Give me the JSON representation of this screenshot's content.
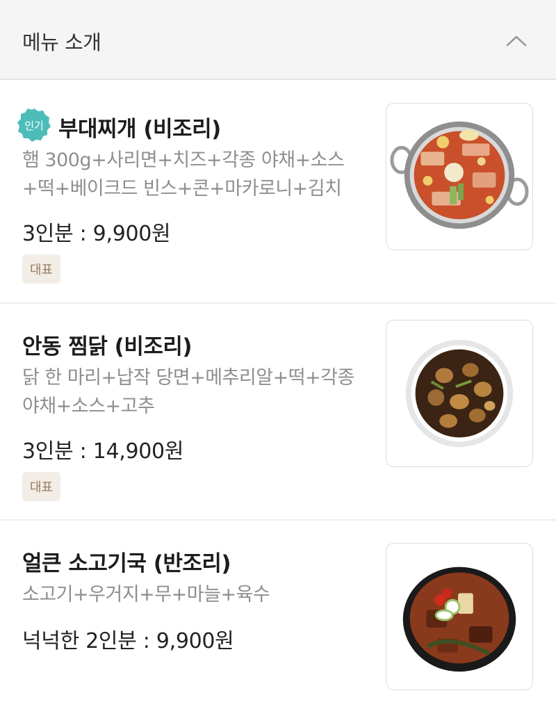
{
  "header": {
    "title": "메뉴 소개",
    "toggle_icon": "chevron-up-icon"
  },
  "menu": {
    "items": [
      {
        "badge": "인기",
        "title": "부대찌개 (비조리)",
        "description": "햄 300g+사리면+치즈+각종 야채+소스+떡+베이크드 빈스+콘+마카로니+김치",
        "price": "3인분 : 9,900원",
        "tag": "대표",
        "image": "budae-jjigae-photo"
      },
      {
        "title": "안동 찜닭 (비조리)",
        "description": "닭 한 마리+납작 당면+메추리알+떡+각종 야채+소스+고추",
        "price": "3인분 : 14,900원",
        "tag": "대표",
        "image": "andong-jjimdak-photo"
      },
      {
        "title": "얼큰 소고기국 (반조리)",
        "description": "소고기+우거지+무+마늘+육수",
        "price": "넉넉한 2인분 : 9,900원",
        "image": "beef-soup-photo"
      }
    ]
  },
  "colors": {
    "header_bg": "#f5f5f5",
    "badge_teal": "#4cbcb9",
    "tag_bg": "#f2ede6",
    "tag_text": "#9a7b5c",
    "desc_text": "#8e8e8e"
  }
}
